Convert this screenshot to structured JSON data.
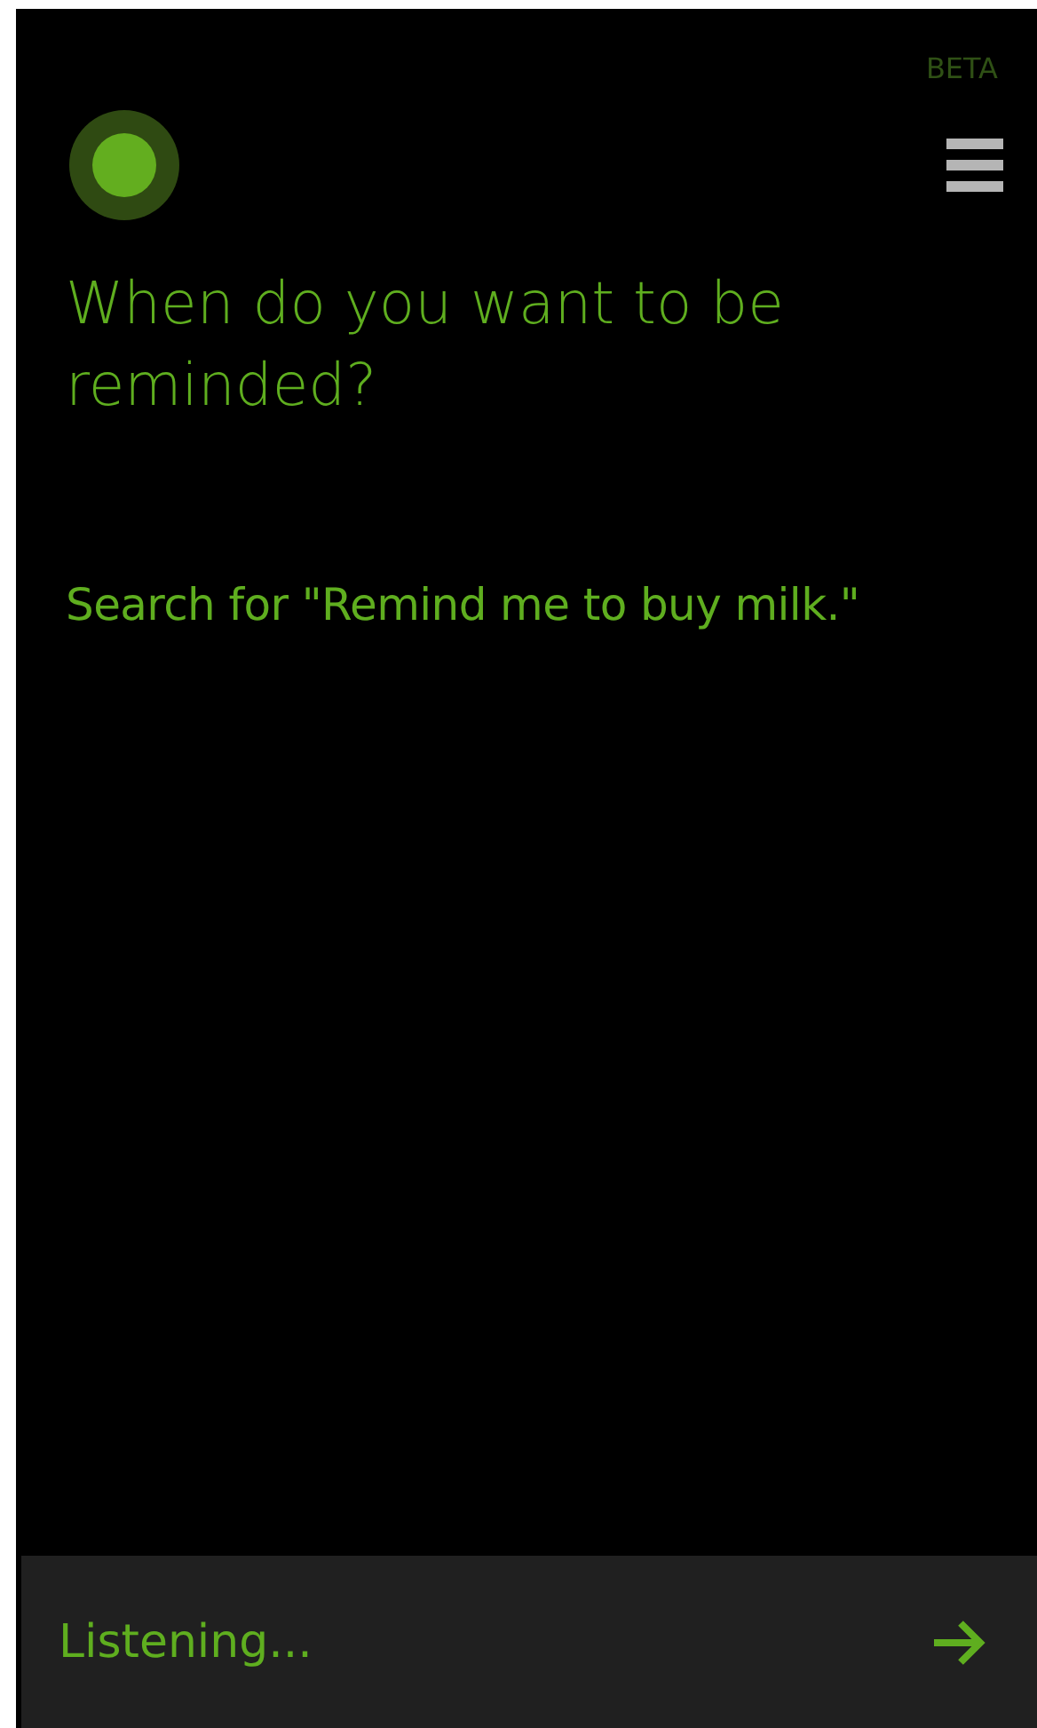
{
  "header": {
    "badge": "BETA"
  },
  "prompt": "When do you want to be reminded?",
  "suggestion": "Search for \"Remind me to buy milk.\"",
  "input_bar": {
    "status": "Listening..."
  }
}
